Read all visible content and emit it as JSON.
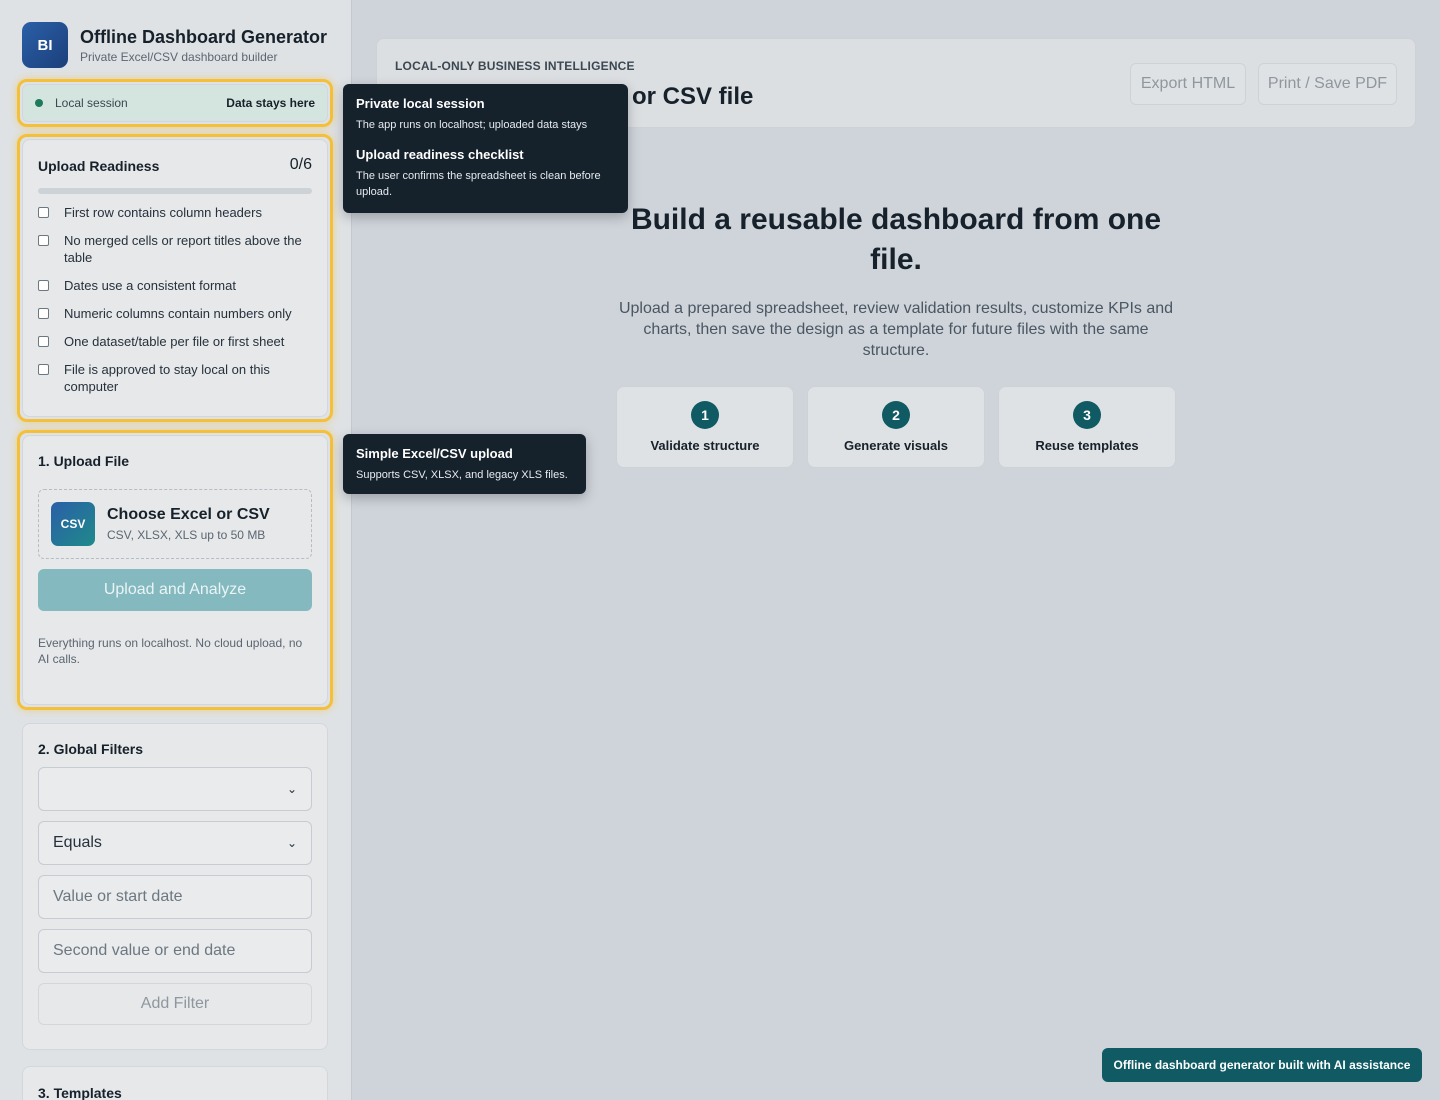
{
  "brand": {
    "logo": "BI",
    "title": "Offline Dashboard Generator",
    "subtitle": "Private Excel/CSV dashboard builder"
  },
  "session": {
    "label": "Local session",
    "right": "Data stays here",
    "status_color": "#1f7a5a"
  },
  "readiness": {
    "title": "Upload Readiness",
    "count": "0/6",
    "progress": 0,
    "items": [
      {
        "label": "First row contains column headers",
        "checked": false
      },
      {
        "label": "No merged cells or report titles above the table",
        "checked": false
      },
      {
        "label": "Dates use a consistent format",
        "checked": false
      },
      {
        "label": "Numeric columns contain numbers only",
        "checked": false
      },
      {
        "label": "One dataset/table per file or first sheet",
        "checked": false
      },
      {
        "label": "File is approved to stay local on this computer",
        "checked": false
      }
    ]
  },
  "upload": {
    "title": "1. Upload File",
    "icon": "CSV",
    "choose_title": "Choose Excel or CSV",
    "choose_sub": "CSV, XLSX, XLS up to 50 MB",
    "button": "Upload and Analyze",
    "note": "Everything runs on localhost. No cloud upload, no AI calls."
  },
  "filters": {
    "title": "2. Global Filters",
    "column_value": "",
    "operator_value": "Equals",
    "value_placeholder": "Value or start date",
    "second_placeholder": "Second value or end date",
    "add_button": "Add Filter"
  },
  "templates": {
    "title": "3. Templates"
  },
  "topbar": {
    "eyebrow": "LOCAL-ONLY BUSINESS INTELLIGENCE",
    "title_visible": "or CSV file",
    "export_button": "Export HTML",
    "print_button": "Print / Save PDF"
  },
  "hero": {
    "title": "Build a reusable dashboard from one file.",
    "description": "Upload a prepared spreadsheet, review validation results, customize KPIs and charts, then save the design as a template for future files with the same structure."
  },
  "steps": [
    {
      "num": "1",
      "label": "Validate structure"
    },
    {
      "num": "2",
      "label": "Generate visuals"
    },
    {
      "num": "3",
      "label": "Reuse templates"
    }
  ],
  "tooltips": {
    "session_title": "Private local session",
    "session_body": "The app runs on localhost; uploaded data stays",
    "checklist_title": "Upload readiness checklist",
    "checklist_body": "The user confirms the spreadsheet is clean before upload.",
    "upload_title": "Simple Excel/CSV upload",
    "upload_body": "Supports CSV, XLSX, and legacy XLS files."
  },
  "footer_badge": "Offline dashboard generator built with AI assistance",
  "colors": {
    "accent": "#0f5a63",
    "highlight": "#f4c03a",
    "brand": "#2a5fa8"
  }
}
